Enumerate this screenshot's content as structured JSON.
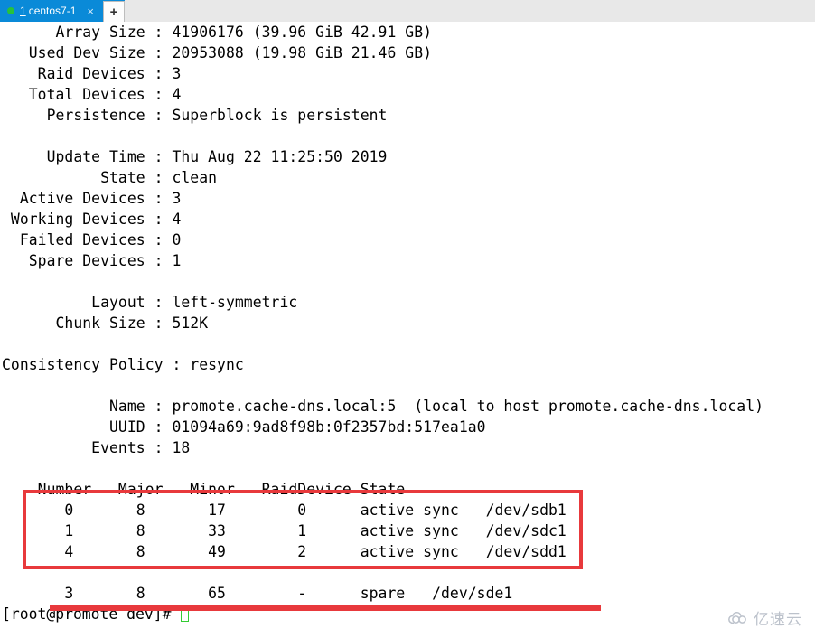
{
  "window": {
    "tab": {
      "index": "1",
      "title": "centos7-1",
      "close_label": "×",
      "status_dot_color": "#27c23c",
      "active_bg_color": "#0a8ad8"
    },
    "new_tab_label": "+"
  },
  "terminal": {
    "lines": [
      "      Array Size : 41906176 (39.96 GiB 42.91 GB)",
      "   Used Dev Size : 20953088 (19.98 GiB 21.46 GB)",
      "    Raid Devices : 3",
      "   Total Devices : 4",
      "     Persistence : Superblock is persistent",
      "",
      "     Update Time : Thu Aug 22 11:25:50 2019",
      "           State : clean",
      "  Active Devices : 3",
      " Working Devices : 4",
      "  Failed Devices : 0",
      "   Spare Devices : 1",
      "",
      "          Layout : left-symmetric",
      "      Chunk Size : 512K",
      "",
      "Consistency Policy : resync",
      "",
      "            Name : promote.cache-dns.local:5  (local to host promote.cache-dns.local)",
      "            UUID : 01094a69:9ad8f98b:0f2357bd:517ea1a0",
      "          Events : 18",
      "",
      "    Number   Major   Minor   RaidDevice State",
      "       0       8       17        0      active sync   /dev/sdb1",
      "       1       8       33        1      active sync   /dev/sdc1",
      "       4       8       49        2      active sync   /dev/sdd1",
      "",
      "       3       8       65        -      spare   /dev/sde1"
    ],
    "prompt": "[root@promote dev]#",
    "cursor_color": "#33cc33"
  },
  "annotations": {
    "color": "#e8393c",
    "box_label": "active-devices-highlight-box",
    "underline_label": "spare-device-highlight-underline"
  },
  "watermark": {
    "text": "亿速云",
    "color": "#b9bfc9"
  }
}
